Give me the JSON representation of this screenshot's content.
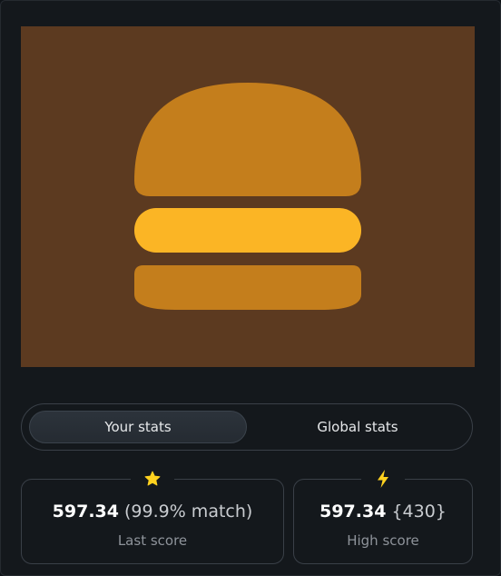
{
  "colors": {
    "background": "#14181c",
    "preview_bg": "#5c3a20",
    "bun": "#c47e1c",
    "cheese": "#fbb525",
    "accent_icon": "#ffd21f"
  },
  "tabs": {
    "your_stats": "Your stats",
    "global_stats": "Global stats",
    "active": "your_stats"
  },
  "last_score": {
    "icon": "star-icon",
    "value": "597.34",
    "match": "(99.9% match)",
    "label": "Last score"
  },
  "high_score": {
    "icon": "lightning-icon",
    "value": "597.34",
    "extra": "{430}",
    "label": "High score"
  }
}
